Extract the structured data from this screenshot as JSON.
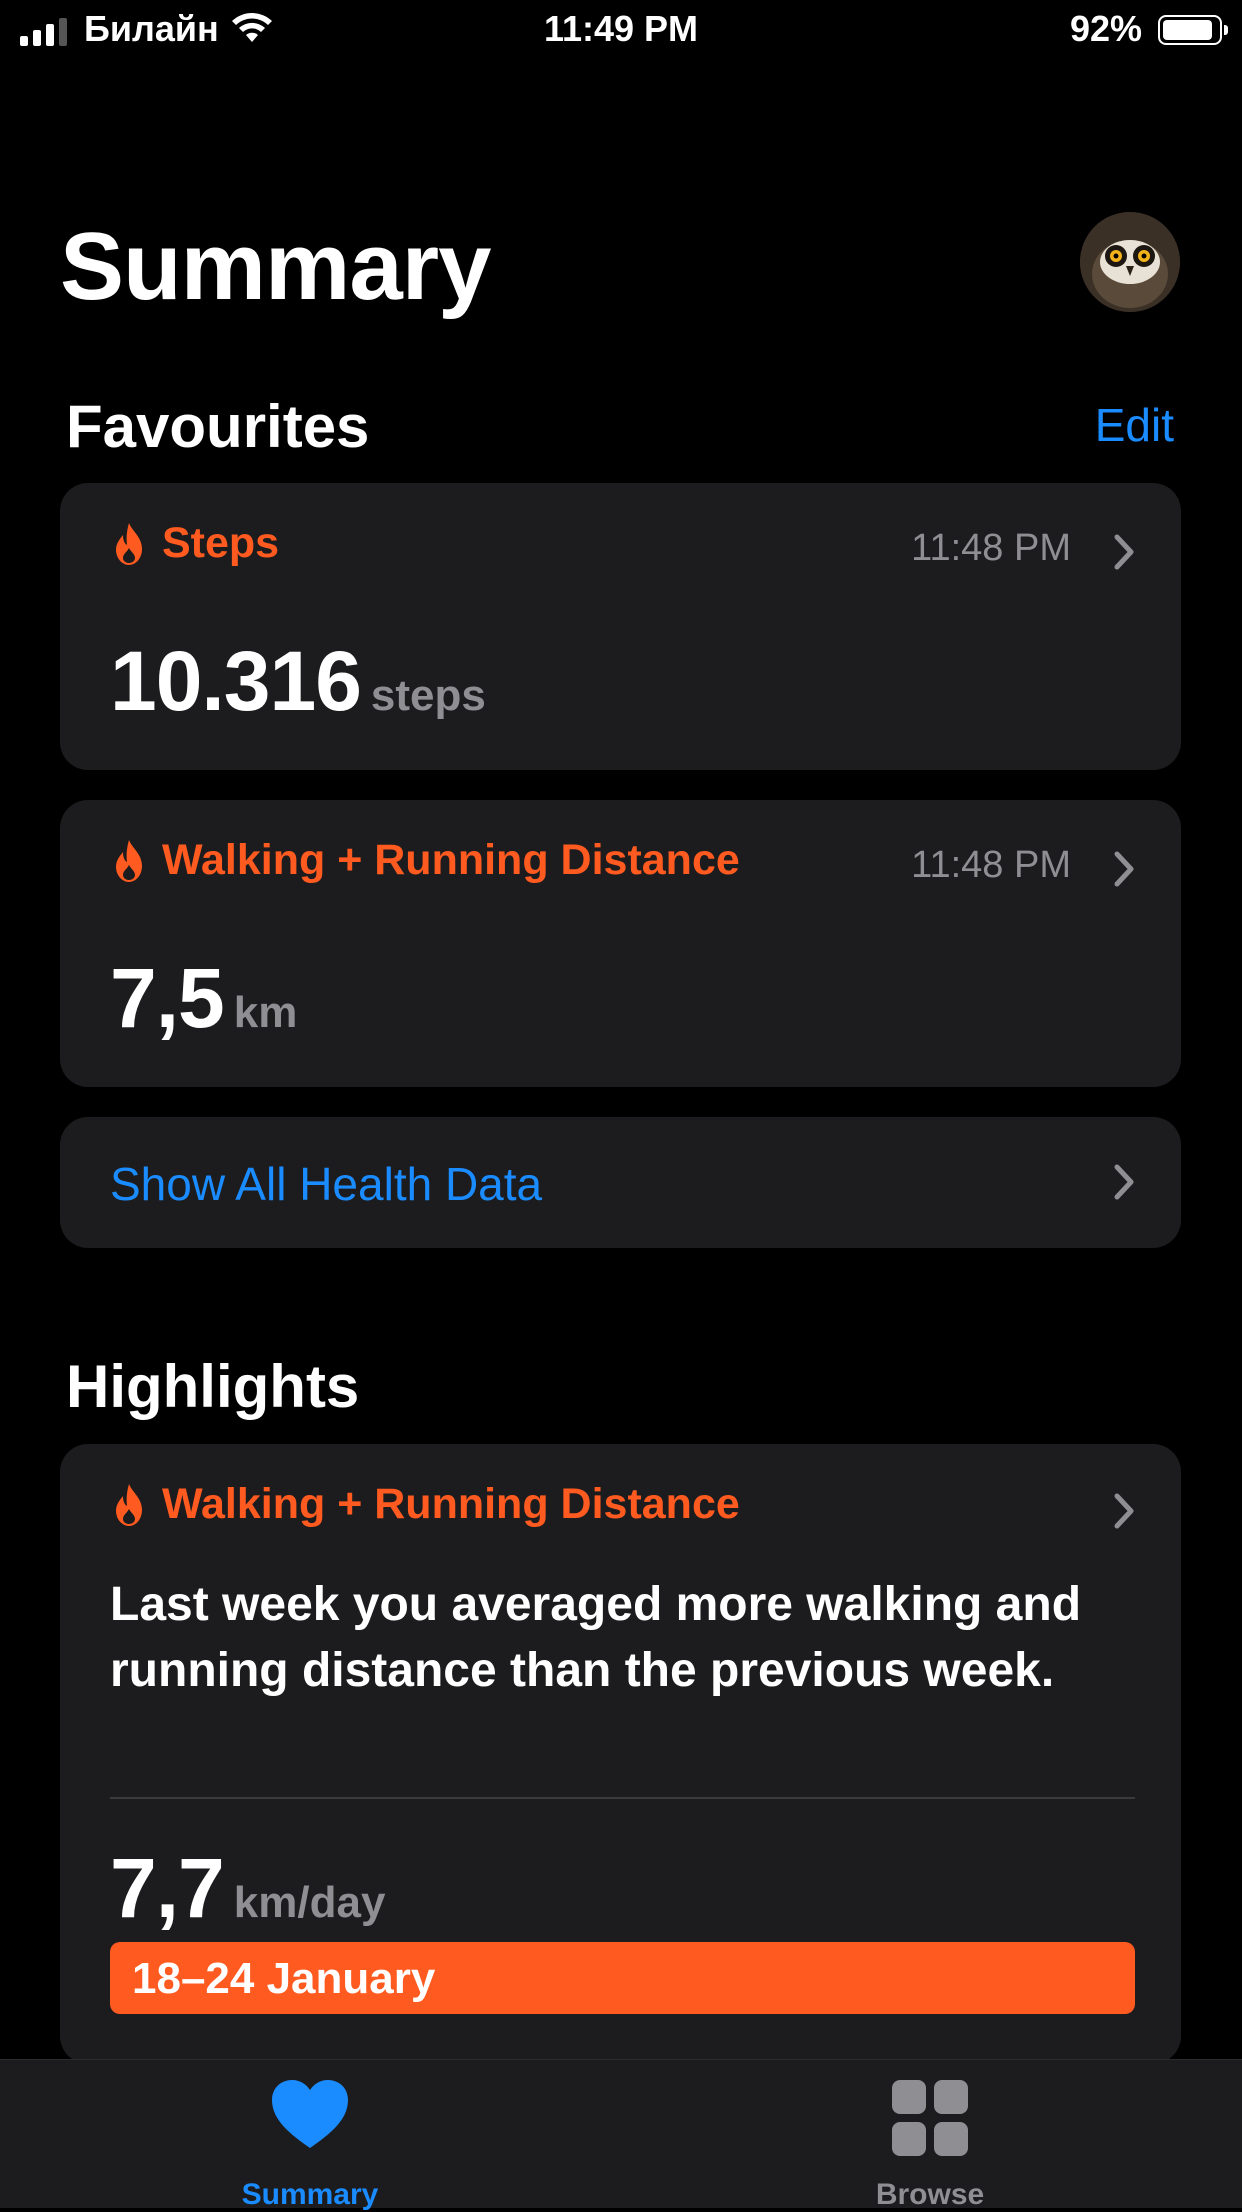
{
  "status_bar": {
    "carrier": "Билайн",
    "time": "11:49 PM",
    "battery_percent": "92%",
    "battery_level": 0.92,
    "signal_bars": 3
  },
  "header": {
    "title": "Summary",
    "avatar_icon": "owl-avatar"
  },
  "favourites": {
    "title": "Favourites",
    "edit_label": "Edit",
    "cards": [
      {
        "title": "Steps",
        "time": "11:48 PM",
        "value": "10.316",
        "unit": "steps",
        "icon": "flame-icon"
      },
      {
        "title": "Walking + Running Distance",
        "time": "11:48 PM",
        "value": "7,5",
        "unit": "km",
        "icon": "flame-icon"
      }
    ],
    "show_all_label": "Show All Health Data"
  },
  "highlights": {
    "title": "Highlights",
    "card": {
      "title": "Walking + Running Distance",
      "text": "Last week you averaged more walking and running distance than the previous week.",
      "value": "7,7",
      "unit": "km/day",
      "range_label": "18–24 January"
    }
  },
  "tabbar": {
    "tabs": [
      {
        "label": "Summary",
        "icon": "heart-icon",
        "active": true
      },
      {
        "label": "Browse",
        "icon": "grid-icon",
        "active": false
      }
    ]
  },
  "colors": {
    "accent_blue": "#1a8cff",
    "orange": "#ff5a1f",
    "card_bg": "#1c1c1e",
    "secondary_text": "#8e8e93"
  }
}
